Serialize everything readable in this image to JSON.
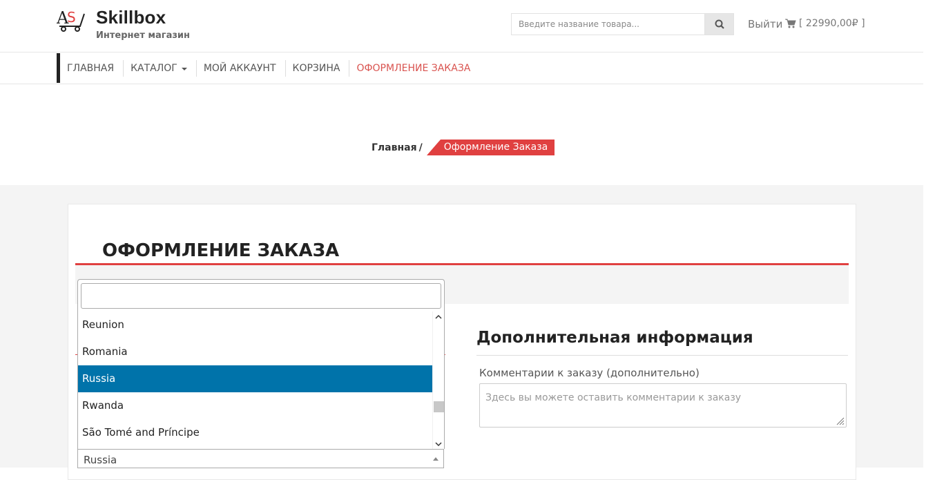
{
  "header": {
    "logo_title": "Skillbox",
    "logo_subtitle": "Интернет магазин",
    "search_placeholder": "Введите название товара...",
    "logout": "Выйти",
    "cart_total": "[ 22990,00₽ ]"
  },
  "nav": {
    "items": [
      "ГЛАВНАЯ",
      "КАТАЛОГ",
      "МОЙ АККАУНТ",
      "КОРЗИНА",
      "ОФОРМЛЕНИЕ ЗАКАЗА"
    ]
  },
  "breadcrumb": {
    "home": "Главная",
    "separator": "/",
    "current": "Оформление Заказа"
  },
  "page": {
    "title": "ОФОРМЛЕНИЕ ЗАКАЗА"
  },
  "additional": {
    "title": "Дополнительная информация",
    "comment_label": "Комментарии к заказу (дополнительно)",
    "comment_placeholder": "Здесь вы можете оставить комментарии к заказу"
  },
  "country_dropdown": {
    "search_value": "",
    "options": [
      "Reunion",
      "Romania",
      "Russia",
      "Rwanda",
      "São Tomé and Príncipe"
    ],
    "highlighted": "Russia",
    "selected": "Russia"
  },
  "colors": {
    "accent": "#e04040",
    "highlight": "#0073aa"
  }
}
